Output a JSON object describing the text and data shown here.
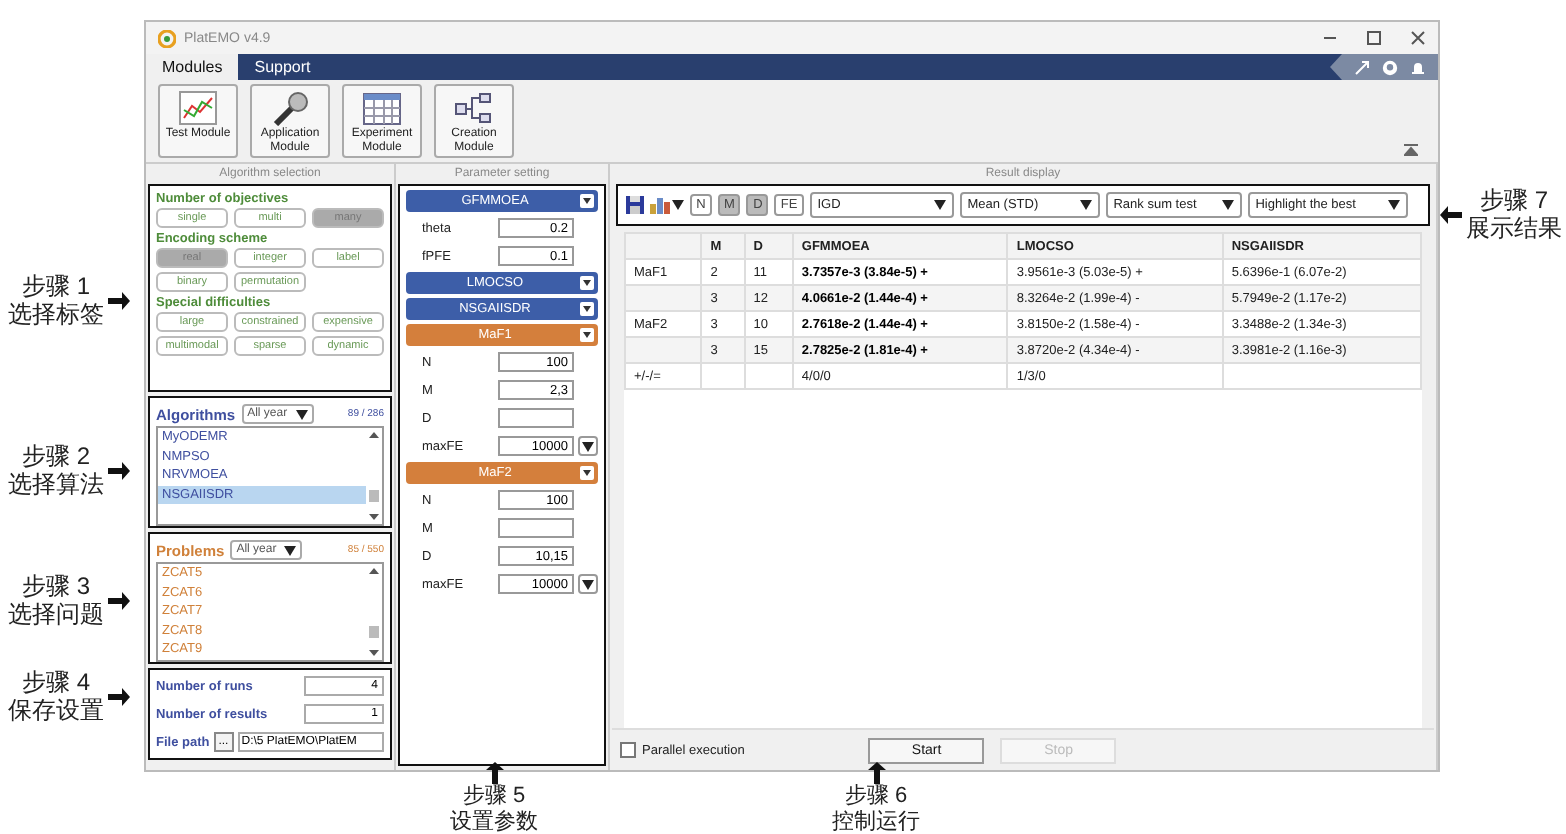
{
  "window": {
    "title": "PlatEMO v4.9"
  },
  "menu_tabs": [
    {
      "label": "Modules",
      "selected": true
    },
    {
      "label": "Support",
      "selected": false
    }
  ],
  "modules": [
    {
      "label": "Test Module",
      "kind": "test"
    },
    {
      "label": "Application Module",
      "kind": "application"
    },
    {
      "label": "Experiment Module",
      "kind": "experiment"
    },
    {
      "label": "Creation Module",
      "kind": "creation"
    }
  ],
  "algorithm_selection": {
    "heading": "Algorithm selection",
    "tag_groups": [
      {
        "title": "Number of objectives",
        "tags": [
          {
            "label": "single",
            "selected": false
          },
          {
            "label": "multi",
            "selected": false
          },
          {
            "label": "many",
            "selected": true
          }
        ]
      },
      {
        "title": "Encoding scheme",
        "tags": [
          {
            "label": "real",
            "selected": true
          },
          {
            "label": "integer",
            "selected": false
          },
          {
            "label": "label",
            "selected": false
          },
          {
            "label": "binary",
            "selected": false
          },
          {
            "label": "permutation",
            "selected": false
          }
        ]
      },
      {
        "title": "Special difficulties",
        "tags": [
          {
            "label": "large",
            "selected": false
          },
          {
            "label": "constrained",
            "selected": false
          },
          {
            "label": "expensive",
            "selected": false
          },
          {
            "label": "multimodal",
            "selected": false
          },
          {
            "label": "sparse",
            "selected": false
          },
          {
            "label": "dynamic",
            "selected": false
          }
        ]
      }
    ],
    "lists": [
      {
        "kind": "algorithms",
        "title": "Algorithms",
        "year": "All year",
        "count": "89 / 286",
        "items": [
          {
            "label": "MyODEMR",
            "selected": false
          },
          {
            "label": "NMPSO",
            "selected": false
          },
          {
            "label": "NRVMOEA",
            "selected": false
          },
          {
            "label": "NSGAIISDR",
            "selected": true
          }
        ]
      },
      {
        "kind": "problems",
        "title": "Problems",
        "year": "All year",
        "count": "85 / 550",
        "items": [
          {
            "label": "ZCAT5",
            "selected": false
          },
          {
            "label": "ZCAT6",
            "selected": false
          },
          {
            "label": "ZCAT7",
            "selected": false
          },
          {
            "label": "ZCAT8",
            "selected": false
          },
          {
            "label": "ZCAT9",
            "selected": false
          }
        ]
      }
    ],
    "settings": {
      "runs_label": "Number of runs",
      "runs": "4",
      "results_label": "Number of results",
      "results": "1",
      "path_label": "File path",
      "browse": "...",
      "path": "D:\\5 PlatEMO\\PlatEM"
    }
  },
  "parameter_setting": {
    "heading": "Parameter setting",
    "blocks": [
      {
        "kind": "algorithm",
        "name": "GFMMOEA",
        "params": [
          {
            "name": "theta",
            "value": "0.2",
            "dropdown": false
          },
          {
            "name": "fPFE",
            "value": "0.1",
            "dropdown": false
          }
        ]
      },
      {
        "kind": "algorithm",
        "name": "LMOCSO"
      },
      {
        "kind": "algorithm",
        "name": "NSGAIISDR"
      },
      {
        "kind": "problem",
        "name": "MaF1",
        "params": [
          {
            "name": "N",
            "value": "100",
            "dropdown": false
          },
          {
            "name": "M",
            "value": "2,3",
            "dropdown": false
          },
          {
            "name": "D",
            "dropdown": false
          },
          {
            "name": "maxFE",
            "value": "10000",
            "dropdown": true
          }
        ]
      },
      {
        "kind": "problem",
        "name": "MaF2",
        "params": [
          {
            "name": "N",
            "value": "100",
            "dropdown": false
          },
          {
            "name": "M",
            "dropdown": false
          },
          {
            "name": "D",
            "value": "10,15",
            "dropdown": false
          },
          {
            "name": "maxFE",
            "value": "10000",
            "dropdown": true
          }
        ]
      }
    ]
  },
  "result_display": {
    "heading": "Result display",
    "toggles": [
      {
        "label": "N",
        "selected": false
      },
      {
        "label": "M",
        "selected": true
      },
      {
        "label": "D",
        "selected": true
      },
      {
        "label": "FE",
        "selected": false
      }
    ],
    "selects": [
      "IGD",
      "Mean (STD)",
      "Rank sum test",
      "Highlight the best"
    ],
    "table": {
      "columns": [
        "",
        "M",
        "D",
        "GFMMOEA",
        "LMOCSO",
        "NSGAIISDR"
      ],
      "rows": [
        {
          "problem": "MaF1",
          "m": "2",
          "d": "11",
          "cells": [
            {
              "text": "3.7357e-3 (3.84e-5) +",
              "best": true
            },
            {
              "text": "3.9561e-3 (5.03e-5) +",
              "best": false
            },
            {
              "text": "5.6396e-1 (6.07e-2)",
              "best": false
            }
          ]
        },
        {
          "problem": "",
          "m": "3",
          "d": "12",
          "cells": [
            {
              "text": "4.0661e-2 (1.44e-4) +",
              "best": true
            },
            {
              "text": "8.3264e-2 (1.99e-4) -",
              "best": false
            },
            {
              "text": "5.7949e-2 (1.17e-2)",
              "best": false
            }
          ]
        },
        {
          "problem": "MaF2",
          "m": "3",
          "d": "10",
          "cells": [
            {
              "text": "2.7618e-2 (1.44e-4) +",
              "best": true
            },
            {
              "text": "3.8150e-2 (1.58e-4) -",
              "best": false
            },
            {
              "text": "3.3488e-2 (1.34e-3)",
              "best": false
            }
          ]
        },
        {
          "problem": "",
          "m": "3",
          "d": "15",
          "cells": [
            {
              "text": "2.7825e-2 (1.81e-4) +",
              "best": true
            },
            {
              "text": "3.8720e-2 (4.34e-4) -",
              "best": false
            },
            {
              "text": "3.3981e-2 (1.16e-3)",
              "best": false
            }
          ]
        },
        {
          "problem": "+/-/=",
          "m": "",
          "d": "",
          "cells": [
            {
              "text": "4/0/0",
              "best": false
            },
            {
              "text": "1/3/0",
              "best": false
            }
          ]
        }
      ]
    },
    "parallel": {
      "label": "Parallel execution",
      "checked": false
    },
    "buttons": [
      {
        "label": "Start",
        "disabled": false
      },
      {
        "label": "Stop",
        "disabled": true
      }
    ]
  },
  "steps": [
    {
      "kind": "left",
      "label": "步骤 1",
      "caption": "选择标签"
    },
    {
      "kind": "left",
      "label": "步骤 2",
      "caption": "选择算法"
    },
    {
      "kind": "left",
      "label": "步骤 3",
      "caption": "选择问题"
    },
    {
      "kind": "left",
      "label": "步骤 4",
      "caption": "保存设置"
    },
    {
      "kind": "bottom",
      "label": "步骤 5",
      "caption": "设置参数"
    },
    {
      "kind": "bottom",
      "label": "步骤 6",
      "caption": "控制运行"
    },
    {
      "kind": "right",
      "label": "步骤 7",
      "caption": "展示结果"
    }
  ]
}
